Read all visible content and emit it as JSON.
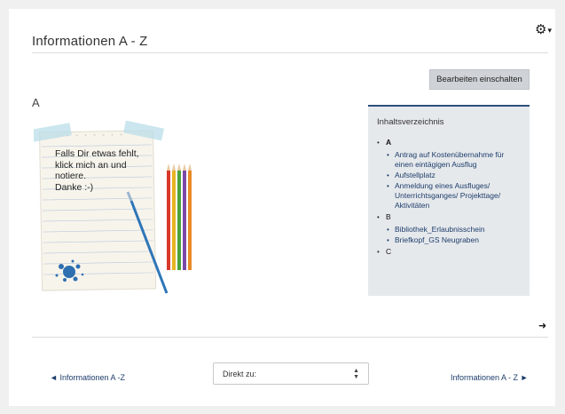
{
  "header": {
    "title": "Informationen A - Z",
    "settings_icon": "gear-icon"
  },
  "section": {
    "letter": "A"
  },
  "note": {
    "text": "Falls Dir etwas fehlt,\nklick mich an und\nnotiere.\nDanke :-)"
  },
  "edit_button": {
    "label": "Bearbeiten einschalten"
  },
  "toc": {
    "title": "Inhaltsverzeichnis",
    "sections": [
      {
        "letter": "A",
        "items": [
          "Antrag auf Kostenübernahme für einen eintägigen Ausflug",
          "Aufstellplatz",
          "Anmeldung eines Ausfluges/ Unterrichtsganges/ Projekttage/ Aktivitäten"
        ]
      },
      {
        "letter": "B",
        "items": [
          "Bibliothek_Erlaubnisschein",
          "Briefkopf_GS Neugraben"
        ]
      },
      {
        "letter": "C",
        "items": []
      }
    ]
  },
  "navigation": {
    "prev_label": "Informationen A -Z",
    "next_label": "Informationen A - Z",
    "jump_placeholder": "Direkt zu:"
  },
  "colors": {
    "link": "#1d3d6b",
    "toc_border": "#2f4e7c",
    "toc_background": "#e6e9ec",
    "button_background": "#cfd3d7"
  }
}
